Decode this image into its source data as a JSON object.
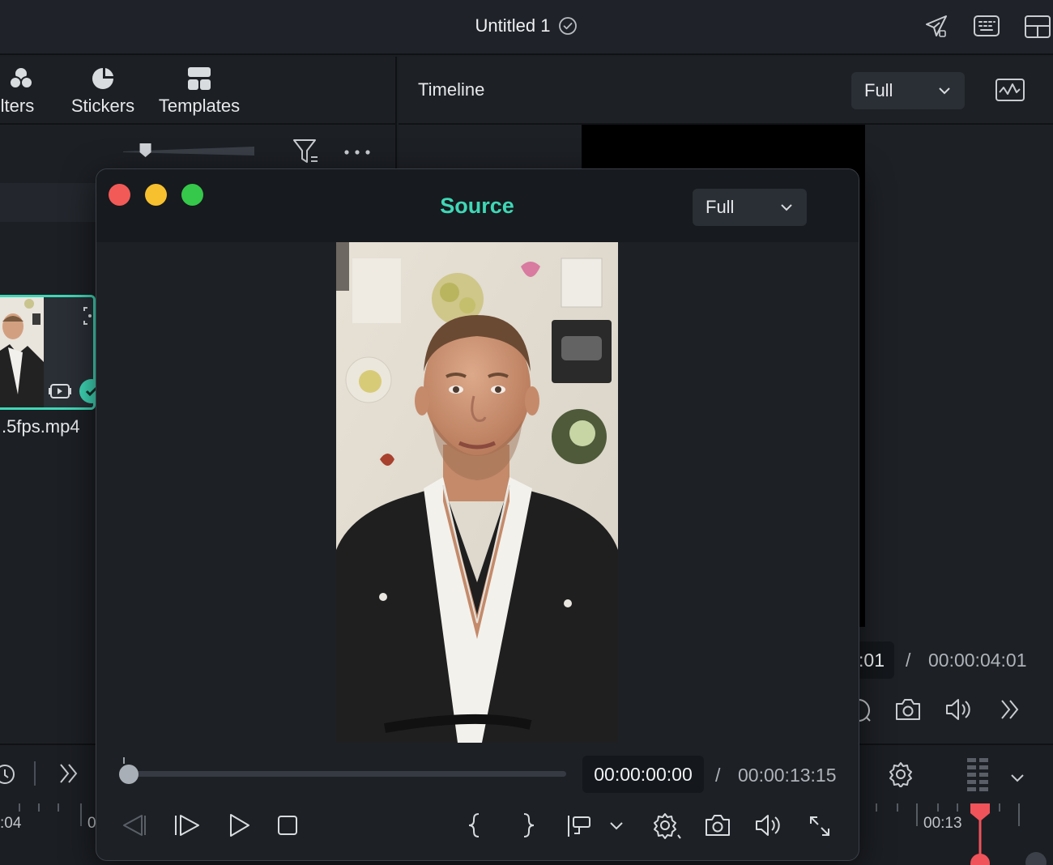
{
  "app": {
    "title": "Untitled 1"
  },
  "left_panel": {
    "tabs": [
      {
        "label": "ilters",
        "icon": "filters-icon"
      },
      {
        "label": "Stickers",
        "icon": "stickers-icon"
      },
      {
        "label": "Templates",
        "icon": "templates-icon"
      }
    ],
    "zoom_slider_level": 0.17,
    "media_item": {
      "filename": ".5fps.mp4"
    }
  },
  "preview_panel": {
    "title": "Timeline",
    "zoom": "Full",
    "current_time_partial": ":01",
    "separator": "/",
    "duration": "00:00:04:01"
  },
  "timeline": {
    "ruler_left": ":04",
    "ruler_left_2": "0",
    "ruler_right": "00:13"
  },
  "source_window": {
    "title": "Source",
    "zoom": "Full",
    "current_time": "00:00:00:00",
    "separator": "/",
    "duration": "00:00:13:15",
    "progress": 0.0
  },
  "colors": {
    "accent": "#3fd7b6",
    "playhead": "#f0535a",
    "close": "#f25a57",
    "minimize": "#f6c02e",
    "zoom": "#35c84a"
  }
}
